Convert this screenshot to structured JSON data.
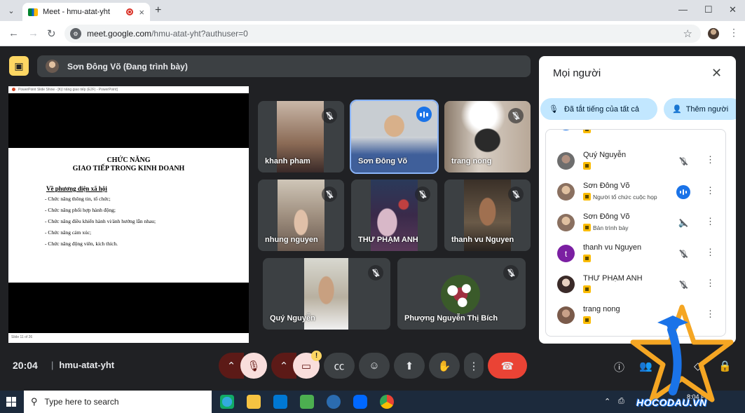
{
  "browser": {
    "tab_title": "Meet - hmu-atat-yht",
    "url_host": "meet.google.com",
    "url_path": "/hmu-atat-yht?authuser=0"
  },
  "meet": {
    "presenter_bar": "Sơn Đông Võ (Đang trình bày)",
    "slide": {
      "window_title": "PowerPoint Slide Show - [Kỹ năng giao tiếp (E2F) - PowerPoint]",
      "heading1": "CHỨC NĂNG",
      "heading2": "GIAO TIẾP TRONG KINH DOANH",
      "subheading": "Về phương diện xã hội",
      "bullets": [
        "- Chức năng thông tin, tổ chức;",
        "- Chức năng phối hợp hành động;",
        "- Chức năng điều khiển hành vi/ảnh hưởng lẫn nhau;",
        "- Chức năng cảm xúc;",
        "- Chức năng động viên, kích thích."
      ],
      "footer": "Slide 11 of 26"
    },
    "tiles": [
      {
        "name": "khanh pham"
      },
      {
        "name": "Sơn Đông Võ"
      },
      {
        "name": "trang nong"
      },
      {
        "name": "nhung nguyen"
      },
      {
        "name": "THƯ PHẠM ANH"
      },
      {
        "name": "thanh vu Nguyen"
      },
      {
        "name": "Quý Nguyễn"
      },
      {
        "name": "Phượng Nguyễn Thị Bích"
      }
    ],
    "time": "20:04",
    "meeting_code": "hmu-atat-yht",
    "notification_count": "!"
  },
  "people_panel": {
    "title": "Mọi người",
    "mute_all": "Đã tắt tiếng của tất cả",
    "add_people": "Thêm người",
    "participants": [
      {
        "name": "Quý Nguyễn",
        "sub": "",
        "avatar_color": "#6d6d6d"
      },
      {
        "name": "Sơn Đông Võ",
        "sub": "Người tổ chức cuộc họp",
        "avatar_color": "#8a7060"
      },
      {
        "name": "Sơn Đông Võ",
        "sub": "Bản trình bày",
        "avatar_color": "#8a7060"
      },
      {
        "name": "thanh vu Nguyen",
        "sub": "",
        "avatar_color": "#7b1fa2",
        "initial": "t"
      },
      {
        "name": "THƯ PHẠM ANH",
        "sub": "",
        "avatar_color": "#5a4a4a"
      },
      {
        "name": "trang nong",
        "sub": "",
        "avatar_color": "#7a5a4a"
      }
    ]
  },
  "taskbar": {
    "search_placeholder": "Type here to search",
    "clock": "8:04 PM"
  },
  "watermark": "HOCODAU.VN"
}
